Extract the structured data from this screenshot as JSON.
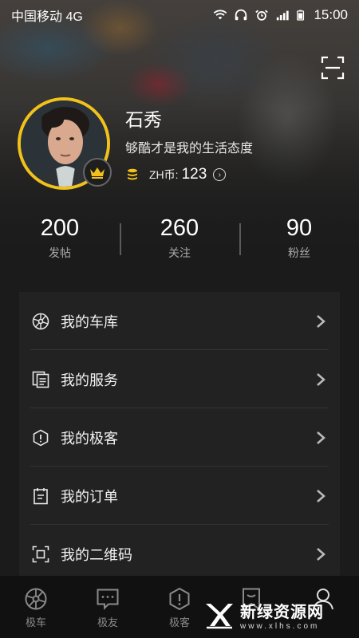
{
  "status_bar": {
    "carrier": "中国移动 4G",
    "time": "15:00",
    "icons": [
      "wifi-icon",
      "headset-icon",
      "alarm-icon",
      "signal-icon",
      "battery-icon"
    ]
  },
  "header": {
    "scan_icon": "scan-icon"
  },
  "profile": {
    "name": "石秀",
    "bio": "够酷才是我的生活态度",
    "coin_label": "ZH币:",
    "coin_value": "123",
    "ring_color": "#f2c21b",
    "badge_icon": "crown-icon"
  },
  "stats": [
    {
      "value": "200",
      "label": "发帖"
    },
    {
      "value": "260",
      "label": "关注"
    },
    {
      "value": "90",
      "label": "粉丝"
    }
  ],
  "menu": {
    "items": [
      {
        "label": "我的车库",
        "icon": "wheel-icon"
      },
      {
        "label": "我的服务",
        "icon": "document-icon"
      },
      {
        "label": "我的极客",
        "icon": "hexagon-info-icon"
      },
      {
        "label": "我的订单",
        "icon": "clipboard-icon"
      },
      {
        "label": "我的二维码",
        "icon": "qr-scan-icon"
      }
    ]
  },
  "tab_bar": {
    "tabs": [
      {
        "label": "极车",
        "icon": "wheel-icon"
      },
      {
        "label": "极友",
        "icon": "chat-icon"
      },
      {
        "label": "极客",
        "icon": "hexagon-info-icon"
      },
      {
        "label": "",
        "icon": "bookmark-icon"
      },
      {
        "label": "",
        "icon": "person-icon"
      }
    ]
  },
  "watermark": {
    "title": "新绿资源网",
    "url": "www.xlhs.com"
  },
  "colors": {
    "accent": "#f2c21b",
    "card": "#222222",
    "background": "#1b1b1b"
  }
}
